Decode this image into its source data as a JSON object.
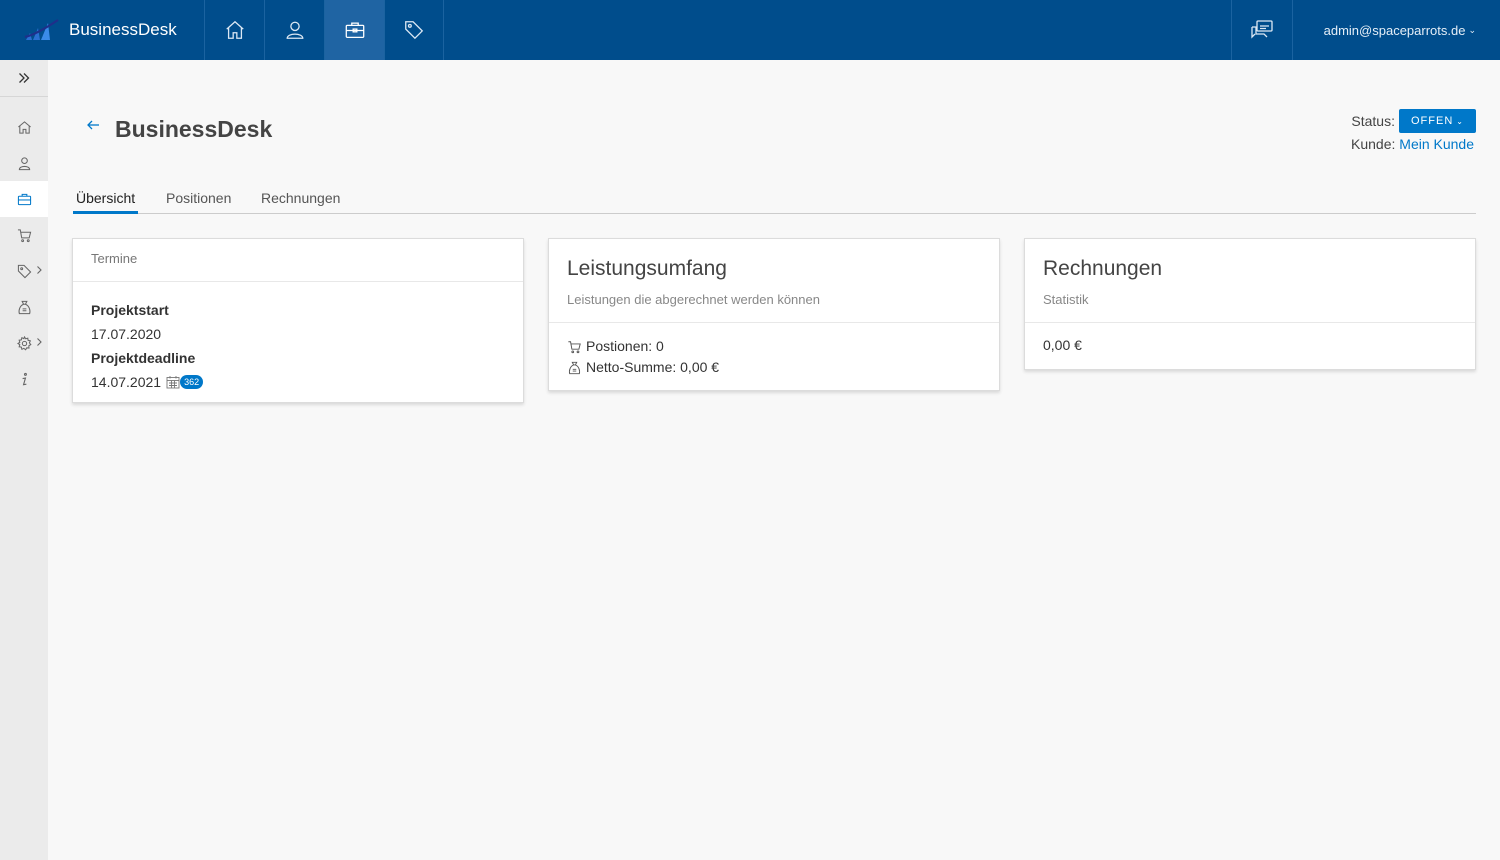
{
  "app": {
    "brand": "BusinessDesk",
    "user_email": "admin@spaceparrots.de"
  },
  "top_nav": [
    {
      "icon": "home-icon"
    },
    {
      "icon": "user-icon"
    },
    {
      "icon": "briefcase-icon",
      "active": true
    },
    {
      "icon": "tag-icon"
    }
  ],
  "sidebar": [
    {
      "icon": "home-icon"
    },
    {
      "icon": "user-icon"
    },
    {
      "icon": "briefcase-icon",
      "active": true
    },
    {
      "icon": "cart-icon"
    },
    {
      "icon": "tag-icon",
      "has_submenu": true
    },
    {
      "icon": "money-bag-icon"
    },
    {
      "icon": "gear-icon",
      "has_submenu": true
    },
    {
      "icon": "info-icon"
    }
  ],
  "page": {
    "title": "BusinessDesk",
    "status_label": "Status:",
    "status_value": "OFFEN",
    "customer_label": "Kunde:",
    "customer_value": "Mein Kunde"
  },
  "tabs": [
    {
      "label": "Übersicht",
      "active": true
    },
    {
      "label": "Positionen"
    },
    {
      "label": "Rechnungen"
    }
  ],
  "cards": {
    "termine": {
      "header": "Termine",
      "start_label": "Projektstart",
      "start_value": "17.07.2020",
      "deadline_label": "Projektdeadline",
      "deadline_value": "14.07.2021",
      "days_badge": "362"
    },
    "leistungsumfang": {
      "title": "Leistungsumfang",
      "subtitle": "Leistungen die abgerechnet werden können",
      "positions": "Postionen: 0",
      "net_sum": "Netto-Summe: 0,00 €"
    },
    "rechnungen": {
      "title": "Rechnungen",
      "subtitle": "Statistik",
      "total": "0,00 €"
    }
  },
  "colors": {
    "topbar": "#004d8c",
    "accent": "#0078c9",
    "sidebar": "#ebebeb",
    "page_bg": "#f8f8f8"
  }
}
